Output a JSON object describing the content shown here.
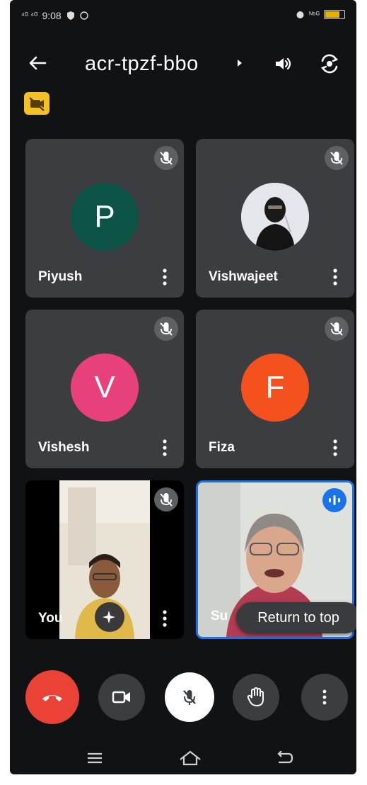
{
  "status_bar": {
    "time": "9:08",
    "left_signals": "⁴ᴳ ⁴ᴳ",
    "right_signals": "ᴺ⁵ᴳ"
  },
  "header": {
    "meeting_code": "acr-tpzf-bbo"
  },
  "participants": [
    {
      "name": "Piyush",
      "initial": "P",
      "avatar_color": "#0b5345",
      "muted": true
    },
    {
      "name": "Vishwajeet",
      "initial": "",
      "muted": true,
      "has_photo": true
    },
    {
      "name": "Vishesh",
      "initial": "V",
      "avatar_color": "#e8407a",
      "muted": true
    },
    {
      "name": "Fiza",
      "initial": "F",
      "avatar_color": "#f4511e",
      "muted": true
    },
    {
      "name": "You",
      "muted": true,
      "has_video": true
    },
    {
      "name": "Su",
      "speaking": true,
      "has_video": true
    }
  ],
  "return_to_top": "Return to top",
  "colors": {
    "end_call": "#ea4335",
    "accent_blue": "#1a73e8",
    "cam_off_badge": "#f5c024"
  }
}
